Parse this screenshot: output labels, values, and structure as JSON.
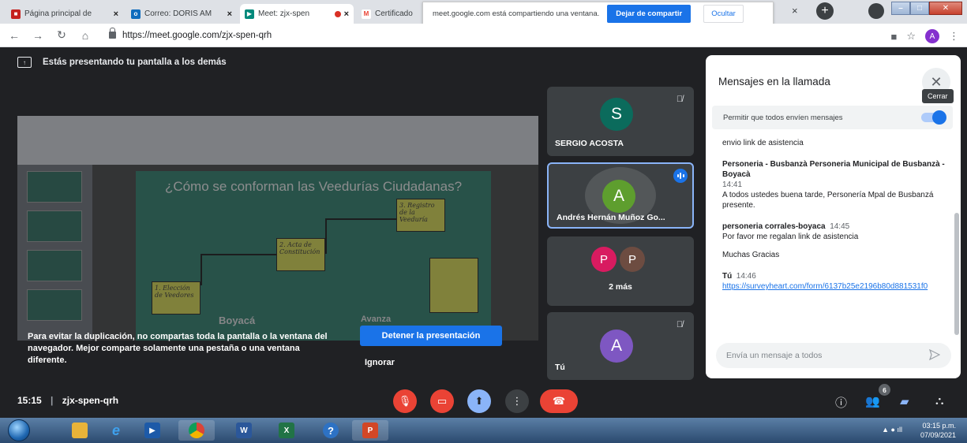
{
  "browser": {
    "tabs": [
      {
        "title": "Página principal de",
        "favicon_color": "#c5221f"
      },
      {
        "title": "Correo: DORIS AM",
        "favicon_color": "#0f6cbd",
        "favicon_text": "o"
      },
      {
        "title": "Meet: zjx-spen",
        "favicon_color": "#00897b",
        "recording": true
      },
      {
        "title": "Certificado",
        "favicon_color": "#ea4335",
        "favicon_text": "M"
      }
    ],
    "tab_close": "×",
    "new_tab": "+",
    "share_bar": {
      "message": "meet.google.com está compartiendo una ventana.",
      "stop_label": "Dejar de compartir",
      "hide_label": "Ocultar"
    },
    "url": "https://meet.google.com/zjx-spen-qrh",
    "profile_initial": "A"
  },
  "meet": {
    "presenting_banner": "Estás presentando tu pantalla a los demás",
    "preview": {
      "slide_title": "¿Cómo se conforman las Veedurías Ciudadanas?",
      "steps": [
        "1. Elección de Veedores",
        "2. Acta de Constitución",
        "3. Registro de la Veeduría"
      ],
      "logo": "Boyacá",
      "logo2": "Avanza"
    },
    "warning_text": "Para evitar la duplicación, no compartas toda la pantalla o la ventana del navegador. Mejor comparte solamente una pestaña o una ventana diferente.",
    "stop_presenting_label": "Detener la presentación",
    "ignore_label": "Ignorar",
    "participants": [
      {
        "initial": "S",
        "name": "SERGIO ACOSTA",
        "color": "#0b6b5c"
      },
      {
        "initial": "A",
        "name": "Andrés Hernán Muñoz Go...",
        "color": "#5e9e2e"
      },
      {
        "initials": [
          "P",
          "P"
        ],
        "name": "2 más",
        "colors": [
          "#d81b60",
          "#6d4c41"
        ]
      },
      {
        "initial": "A",
        "name": "Tú",
        "color": "#7e57c2"
      }
    ],
    "meeting_time": "15:15",
    "meeting_code": "zjx-spen-qrh",
    "people_count": "6"
  },
  "chat": {
    "title": "Mensajes en la llamada",
    "close_tooltip": "Cerrar",
    "permit_label": "Permitir que todos envíen mensajes",
    "messages": [
      {
        "text": "envio link de asistencia"
      },
      {
        "sender": "Personeria - Busbanzà Personeria Municipal de Busbanzà - Boyacà",
        "time": "14:41",
        "text": "A todos ustedes buena tarde, Personería Mpal de Busbanzá presente."
      },
      {
        "sender": "personeria corrales-boyaca",
        "time": "14:45",
        "text": "Por favor me regalan link de asistencia",
        "text2": "Muchas Gracias"
      },
      {
        "sender": "Tú",
        "time": "14:46",
        "link": "https://surveyheart.com/form/6137b25e2196b80d881531f0"
      }
    ],
    "input_placeholder": "Envía un mensaje a todos"
  },
  "taskbar": {
    "time": "03:15 p.m.",
    "date": "07/09/2021"
  }
}
